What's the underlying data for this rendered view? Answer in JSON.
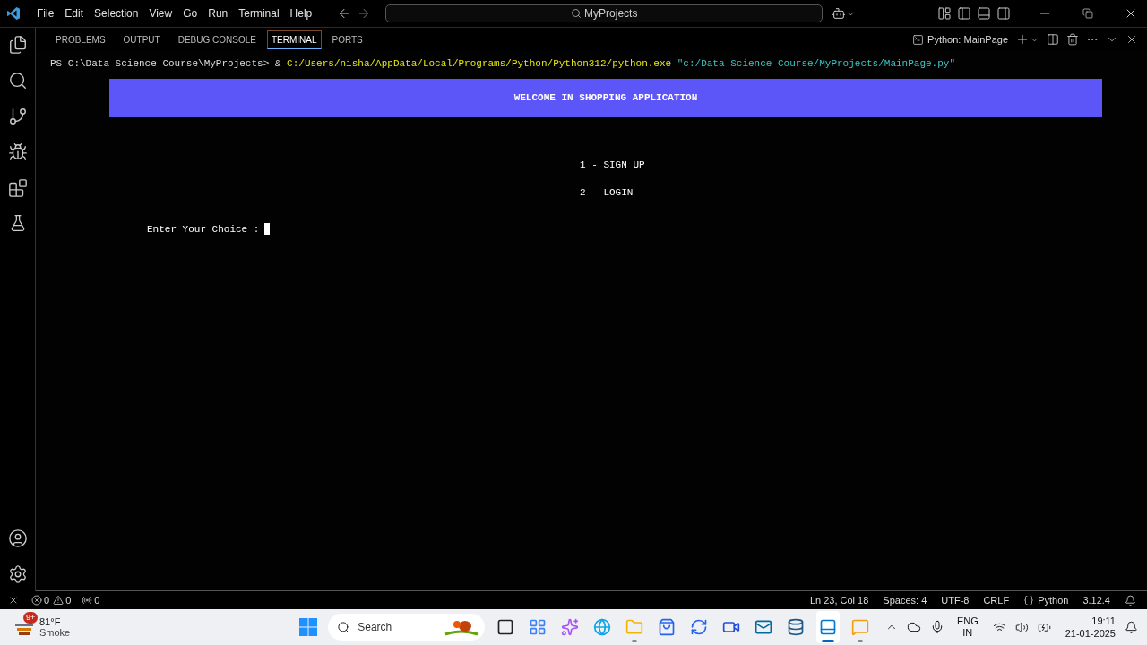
{
  "menu": [
    "File",
    "Edit",
    "Selection",
    "View",
    "Go",
    "Run",
    "Terminal",
    "Help"
  ],
  "command_center": "MyProjects",
  "panel": {
    "tabs": [
      {
        "label": "PROBLEMS",
        "selected": false
      },
      {
        "label": "OUTPUT",
        "selected": false
      },
      {
        "label": "DEBUG CONSOLE",
        "selected": false
      },
      {
        "label": "TERMINAL",
        "selected": true
      },
      {
        "label": "PORTS",
        "selected": false
      }
    ],
    "terminal_name": "Python: MainPage"
  },
  "terminal": {
    "prompt": "PS C:\\Data Science Course\\MyProjects>",
    "operator": "&",
    "executable": "C:/Users/nisha/AppData/Local/Programs/Python/Python312/python.exe",
    "argument": "\"c:/Data Science Course/MyProjects/MainPage.py\"",
    "banner": "WELCOME IN SHOPPING APPLICATION",
    "options": [
      "1 - SIGN UP",
      "2 - LOGIN"
    ],
    "input_prompt": "Enter Your Choice :"
  },
  "status_bar": {
    "errors": "0",
    "warnings": "0",
    "ports": "0",
    "right": [
      {
        "kind": "text",
        "label": "Ln 23, Col 18"
      },
      {
        "kind": "text",
        "label": "Spaces: 4"
      },
      {
        "kind": "text",
        "label": "UTF-8"
      },
      {
        "kind": "text",
        "label": "CRLF"
      },
      {
        "kind": "language",
        "label": "Python"
      },
      {
        "kind": "text",
        "label": "3.12.4"
      }
    ]
  },
  "taskbar": {
    "weather": {
      "badge": "9+",
      "temperature": "81°F",
      "condition": "Smoke"
    },
    "search": "Search",
    "apps": [
      {
        "kind": "files",
        "running": false,
        "selected": false
      },
      {
        "kind": "widgets",
        "running": false,
        "selected": false
      },
      {
        "kind": "copilot",
        "running": false,
        "selected": false
      },
      {
        "kind": "edge",
        "running": false,
        "selected": false
      },
      {
        "kind": "explorer",
        "running": true,
        "selected": false
      },
      {
        "kind": "store",
        "running": false,
        "selected": false
      },
      {
        "kind": "sync",
        "running": false,
        "selected": false
      },
      {
        "kind": "meet",
        "running": false,
        "selected": false
      },
      {
        "kind": "outlook",
        "running": false,
        "selected": false
      },
      {
        "kind": "mysql",
        "running": false,
        "selected": false
      },
      {
        "kind": "editor",
        "running": true,
        "selected": true
      },
      {
        "kind": "chat",
        "running": true,
        "selected": false
      }
    ],
    "language": [
      "ENG",
      "IN"
    ],
    "time": "19:11",
    "date": "21-01-2025"
  }
}
